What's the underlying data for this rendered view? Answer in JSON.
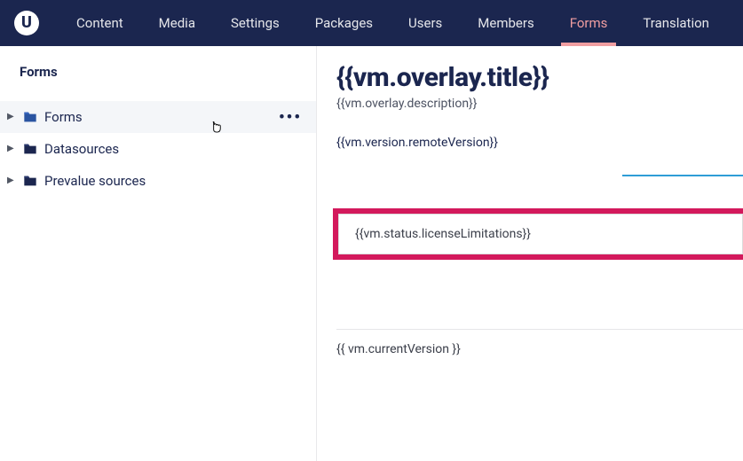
{
  "nav": {
    "items": [
      {
        "label": "Content",
        "active": false
      },
      {
        "label": "Media",
        "active": false
      },
      {
        "label": "Settings",
        "active": false
      },
      {
        "label": "Packages",
        "active": false
      },
      {
        "label": "Users",
        "active": false
      },
      {
        "label": "Members",
        "active": false
      },
      {
        "label": "Forms",
        "active": true
      },
      {
        "label": "Translation",
        "active": false
      }
    ]
  },
  "sidebar": {
    "section_title": "Forms",
    "items": [
      {
        "label": "Forms",
        "folder_color": "#2a54a1",
        "selected": true
      },
      {
        "label": "Datasources",
        "folder_color": "#1b264f",
        "selected": false
      },
      {
        "label": "Prevalue sources",
        "folder_color": "#1b264f",
        "selected": false
      }
    ]
  },
  "main": {
    "title": "{{vm.overlay.title}}",
    "description": "{{vm.overlay.description}}",
    "remote_version": "{{vm.version.remoteVersion}}",
    "license_limitations": "{{vm.status.licenseLimitations}}",
    "current_version": "{{ vm.currentVersion }}"
  },
  "colors": {
    "topbar": "#1b264f",
    "accent_pink": "#f09ea1",
    "alert": "#d3195c",
    "tab_underline": "#2e9dd6"
  }
}
